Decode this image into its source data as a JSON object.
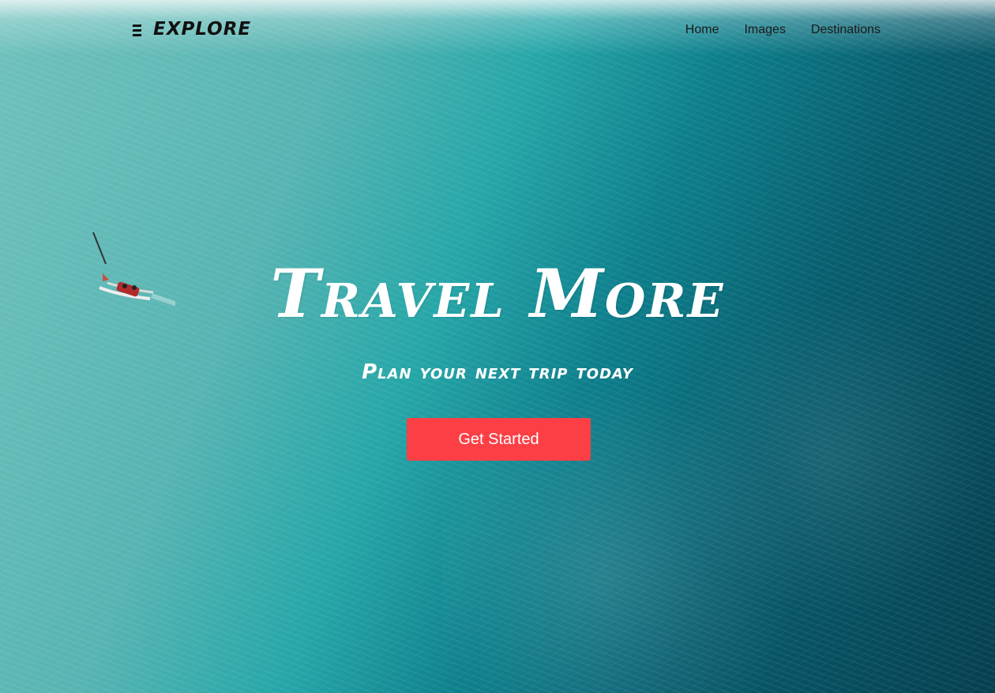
{
  "brand": {
    "name": "EXPLORE",
    "menu_icon": "hamburger-menu-icon"
  },
  "nav": {
    "links": [
      {
        "label": "Home"
      },
      {
        "label": "Images"
      },
      {
        "label": "Destinations"
      }
    ]
  },
  "hero": {
    "title": "Travel More",
    "subtitle": "Plan your next trip today",
    "cta_label": "Get Started",
    "cta_color": "#fb3f45",
    "background": "aerial-ocean-photo-with-sailboat"
  }
}
